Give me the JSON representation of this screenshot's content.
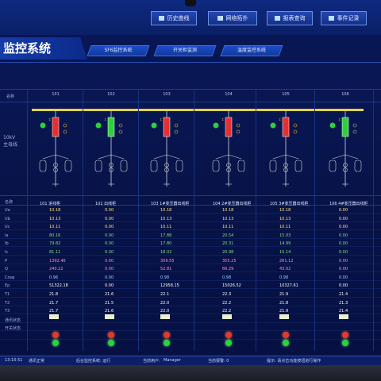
{
  "topbar": {
    "buttons": [
      {
        "label": "历史曲线"
      },
      {
        "label": "网络拓扑"
      },
      {
        "label": "报表查询"
      },
      {
        "label": "事件记录"
      }
    ]
  },
  "header": {
    "title": "监控系统",
    "tabs": [
      {
        "label": "SF6监控系统"
      },
      {
        "label": "开关柜监测"
      },
      {
        "label": "温度监控系统"
      }
    ]
  },
  "table": {
    "row_labels": [
      "名称",
      "Ua",
      "Ub",
      "Uc",
      "Ia",
      "Ib",
      "Ic",
      "P",
      "Q",
      "Cosφ",
      "Ep",
      "T1",
      "T2",
      "T3",
      "通讯状态",
      "开关状态"
    ],
    "left_label": "10kV\n主母线",
    "columns": [
      {
        "head": "101",
        "name": "101 进线柜",
        "sw": "red",
        "values": [
          "10.18",
          "10.13",
          "10.11",
          "80.16",
          "79.82",
          "81.11",
          "1392.46",
          "240.22",
          "0.96",
          "51322.18"
        ],
        "colors": [
          "#ffe37a",
          "#ffe37a",
          "#ffe37a",
          "#7fe08c",
          "#7fe08c",
          "#7fe08c",
          "#ff8cd6",
          "#ff8cd6",
          "#8fd5ff",
          "#ffffff"
        ],
        "temps": [
          "21.8",
          "21.7",
          "21.7"
        ],
        "lamps": [
          "red",
          "green"
        ]
      },
      {
        "head": "102",
        "name": "102 出线柜",
        "sw": "green",
        "values": [
          "0.00",
          "0.00",
          "0.00",
          "0.00",
          "0.00",
          "0.00",
          "0.00",
          "0.00",
          "0.00",
          "0.00"
        ],
        "colors": [
          "#ffe37a",
          "#ffe37a",
          "#ffe37a",
          "#7fe08c",
          "#7fe08c",
          "#7fe08c",
          "#ff8cd6",
          "#ff8cd6",
          "#8fd5ff",
          "#ffffff"
        ],
        "temps": [
          "21.6",
          "21.5",
          "21.6"
        ],
        "lamps": [
          "red",
          "green"
        ]
      },
      {
        "head": "103",
        "name": "103 1#变压器出线柜",
        "sw": "red",
        "values": [
          "10.18",
          "10.13",
          "10.11",
          "17.88",
          "17.80",
          "18.02",
          "309.55",
          "52.81",
          "0.98",
          "12958.15"
        ],
        "colors": [
          "#ffe37a",
          "#ffe37a",
          "#ffe37a",
          "#7fe08c",
          "#7fe08c",
          "#7fe08c",
          "#ff8cd6",
          "#ff8cd6",
          "#8fd5ff",
          "#ffffff"
        ],
        "temps": [
          "22.1",
          "22.0",
          "22.0"
        ],
        "lamps": [
          "red",
          "green"
        ]
      },
      {
        "head": "104",
        "name": "104 2#变压器出线柜",
        "sw": "red",
        "values": [
          "10.18",
          "10.13",
          "10.11",
          "20.54",
          "20.31",
          "20.98",
          "355.25",
          "66.29",
          "0.98",
          "15026.52"
        ],
        "colors": [
          "#ffe37a",
          "#ffe37a",
          "#ffe37a",
          "#7fe08c",
          "#7fe08c",
          "#7fe08c",
          "#ff8cd6",
          "#ff8cd6",
          "#8fd5ff",
          "#ffffff"
        ],
        "temps": [
          "22.3",
          "22.2",
          "22.2"
        ],
        "lamps": [
          "red",
          "green"
        ]
      },
      {
        "head": "105",
        "name": "105 3#变压器出线柜",
        "sw": "red",
        "values": [
          "10.18",
          "10.13",
          "10.11",
          "15.03",
          "14.99",
          "15.14",
          "261.12",
          "43.02",
          "0.98",
          "10327.61"
        ],
        "colors": [
          "#ffe37a",
          "#ffe37a",
          "#ffe37a",
          "#7fe08c",
          "#7fe08c",
          "#7fe08c",
          "#ff8cd6",
          "#ff8cd6",
          "#8fd5ff",
          "#ffffff"
        ],
        "temps": [
          "21.9",
          "21.8",
          "21.9"
        ],
        "lamps": [
          "red",
          "green"
        ]
      },
      {
        "head": "106",
        "name": "106 4#变压器出线柜",
        "sw": "green",
        "values": [
          "0.00",
          "0.00",
          "0.00",
          "0.00",
          "0.00",
          "0.00",
          "0.00",
          "0.00",
          "0.00",
          "0.00"
        ],
        "colors": [
          "#ffe37a",
          "#ffe37a",
          "#ffe37a",
          "#7fe08c",
          "#7fe08c",
          "#7fe08c",
          "#ff8cd6",
          "#ff8cd6",
          "#8fd5ff",
          "#ffffff"
        ],
        "temps": [
          "21.4",
          "21.3",
          "21.4"
        ],
        "lamps": [
          "red",
          "green"
        ]
      }
    ]
  },
  "taskbar": {
    "time": "13:10:51",
    "status": "通讯正常",
    "server": "后台监控系统: 运行",
    "user_label": "当前用户:",
    "user": "Manager",
    "alarm": "当前报警: 0",
    "tip": "提示: 请点击功能按钮进行操作"
  }
}
